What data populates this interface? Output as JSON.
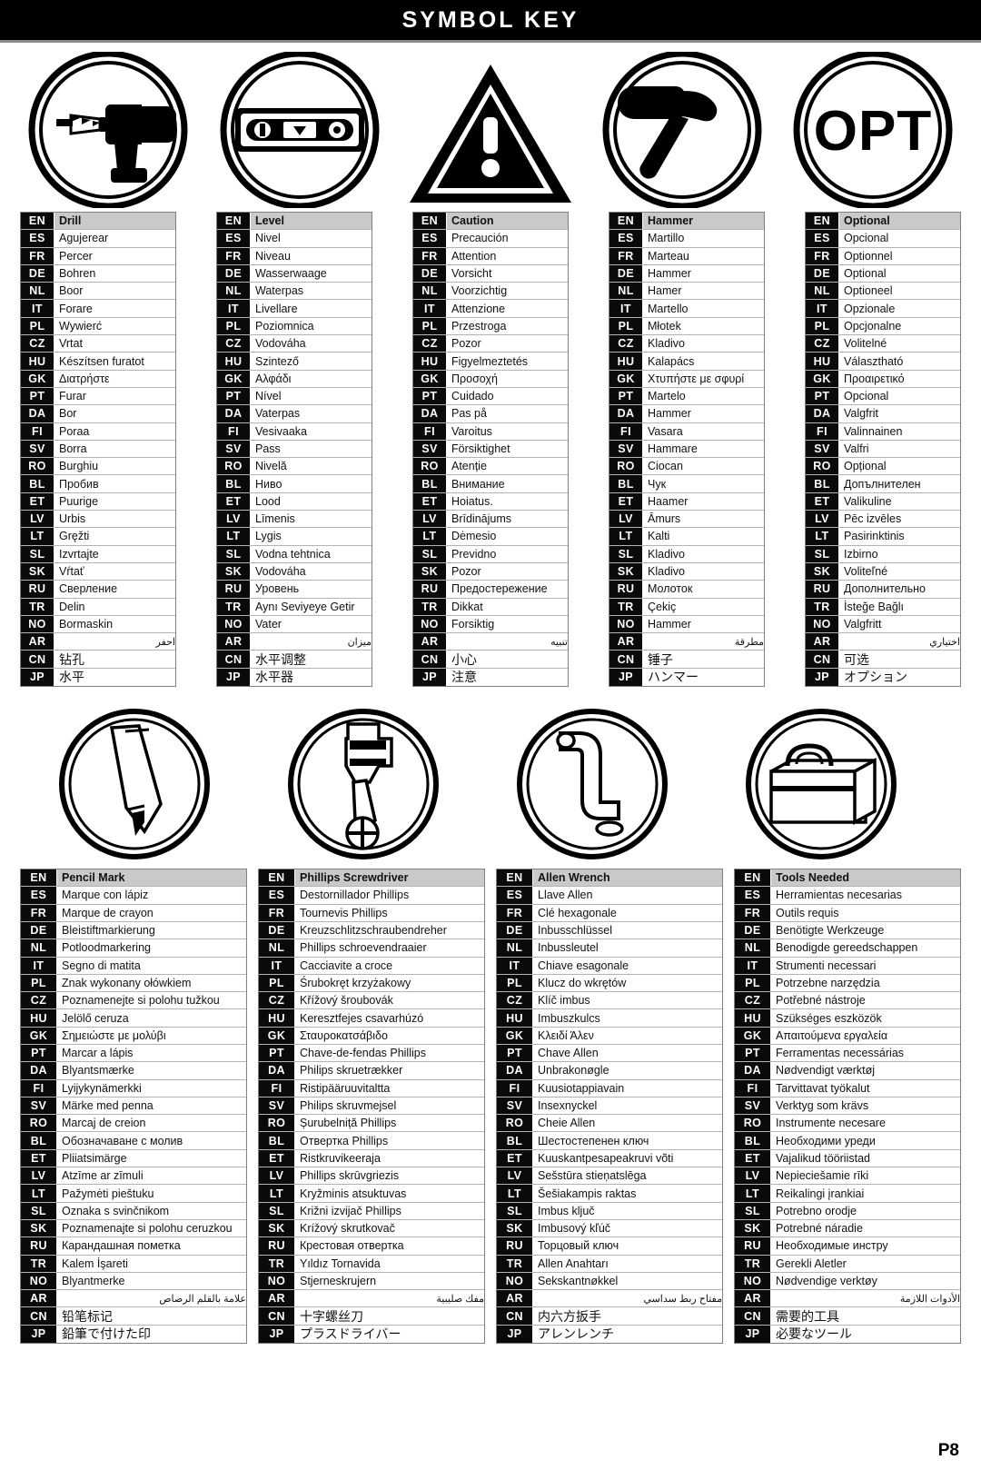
{
  "header": {
    "title": "SYMBOL KEY"
  },
  "footer": {
    "page": "P8"
  },
  "language_codes": [
    "EN",
    "ES",
    "FR",
    "DE",
    "NL",
    "IT",
    "PL",
    "CZ",
    "HU",
    "GK",
    "PT",
    "DA",
    "FI",
    "SV",
    "RO",
    "BL",
    "ET",
    "LV",
    "LT",
    "SL",
    "SK",
    "RU",
    "TR",
    "NO",
    "AR",
    "CN",
    "JP"
  ],
  "icons_top": [
    {
      "name": "drill-icon",
      "label": "Drill"
    },
    {
      "name": "level-icon",
      "label": "Level"
    },
    {
      "name": "caution-triangle-icon",
      "label": "Caution"
    },
    {
      "name": "hammer-icon",
      "label": "Hammer"
    },
    {
      "name": "optional-opt-icon",
      "label": "OPT"
    }
  ],
  "icons_bottom": [
    {
      "name": "pencil-icon",
      "label": "Pencil Mark"
    },
    {
      "name": "phillips-screwdriver-icon",
      "label": "Phillips Screwdriver"
    },
    {
      "name": "allen-wrench-icon",
      "label": "Allen Wrench"
    },
    {
      "name": "toolbox-icon",
      "label": "Tools Needed"
    }
  ],
  "tables_top": [
    {
      "id": "drill",
      "terms": [
        "Drill",
        "Agujerear",
        "Percer",
        "Bohren",
        "Boor",
        "Forare",
        "Wywierć",
        "Vrtat",
        "Készítsen furatot",
        "Διατρήστε",
        "Furar",
        "Bor",
        "Poraa",
        "Borra",
        "Burghiu",
        "Пробив",
        "Puurige",
        "Urbis",
        "Gręžti",
        "Izvrtajte",
        "Vŕtať",
        "Сверление",
        "Delin",
        "Bormaskin",
        "احفر",
        "钻孔",
        "水平"
      ]
    },
    {
      "id": "level",
      "terms": [
        "Level",
        "Nivel",
        "Niveau",
        "Wasserwaage",
        "Waterpas",
        "Livellare",
        "Poziomnica",
        "Vodováha",
        "Szintező",
        "Αλφάδι",
        "Nível",
        "Vaterpas",
        "Vesivaaka",
        "Pass",
        "Nivelă",
        "Ниво",
        "Lood",
        "Līmenis",
        "Lygis",
        "Vodna tehtnica",
        "Vodováha",
        "Уровень",
        "Aynı Seviyeye Getir",
        "Vater",
        "ميزان",
        "水平调整",
        "水平器"
      ]
    },
    {
      "id": "caution",
      "terms": [
        "Caution",
        "Precaución",
        "Attention",
        "Vorsicht",
        "Voorzichtig",
        "Attenzione",
        "Przestroga",
        "Pozor",
        "Figyelmeztetés",
        "Προσοχή",
        "Cuidado",
        "Pas på",
        "Varoitus",
        "Försiktighet",
        "Atenție",
        "Внимание",
        "Hoiatus.",
        "Brīdinājums",
        "Dėmesio",
        "Previdno",
        "Pozor",
        "Предостережение",
        "Dikkat",
        "Forsiktig",
        "تنبيه",
        "小心",
        "注意"
      ]
    },
    {
      "id": "hammer",
      "terms": [
        "Hammer",
        "Martillo",
        "Marteau",
        "Hammer",
        "Hamer",
        "Martello",
        "Młotek",
        "Kladivo",
        "Kalapács",
        "Χτυπήστε με σφυρί",
        "Martelo",
        "Hammer",
        "Vasara",
        "Hammare",
        "Ciocan",
        "Чук",
        "Haamer",
        "Āmurs",
        "Kalti",
        "Kladivo",
        "Kladivo",
        "Молоток",
        "Çekiç",
        "Hammer",
        "مطرقة",
        "锤子",
        "ハンマー"
      ]
    },
    {
      "id": "optional",
      "terms": [
        "Optional",
        "Opcional",
        "Optionnel",
        "Optional",
        "Optioneel",
        "Opzionale",
        "Opcjonalne",
        "Volitelné",
        "Választható",
        "Προαιρετικό",
        "Opcional",
        "Valgfrit",
        "Valinnainen",
        "Valfri",
        "Opțional",
        "Допълнителен",
        "Valikuline",
        "Pēc izvēles",
        "Pasirinktinis",
        "Izbirno",
        "Voliteľné",
        "Дополнительно",
        "İsteğe Bağlı",
        "Valgfritt",
        "اختياري",
        "可选",
        "オプション"
      ]
    }
  ],
  "tables_bottom": [
    {
      "id": "pencil-mark",
      "terms": [
        "Pencil Mark",
        "Marque con lápiz",
        "Marque de crayon",
        "Bleistiftmarkierung",
        "Potloodmarkering",
        "Segno di matita",
        "Znak wykonany ołówkiem",
        "Poznamenejte si polohu tužkou",
        "Jelölő ceruza",
        "Σημειώστε με μολύβι",
        "Marcar a lápis",
        "Blyantsmærke",
        "Lyijykynämerkki",
        "Märke med penna",
        "Marcaj de creion",
        "Обозначаване с молив",
        "Pliiatsimärge",
        "Atzīme ar zīmuli",
        "Pažymėti pieštuku",
        "Oznaka s svinčnikom",
        "Poznamenajte si polohu ceruzkou",
        "Карандашная пометка",
        "Kalem İşareti",
        "Blyantmerke",
        "علامة بالقلم الرصاص",
        "铅笔标记",
        "鉛筆で付けた印"
      ]
    },
    {
      "id": "phillips-screwdriver",
      "terms": [
        "Phillips Screwdriver",
        "Destornillador Phillips",
        "Tournevis Phillips",
        "Kreuzschlitzschraubendreher",
        "Phillips schroevendraaier",
        "Cacciavite a croce",
        "Śrubokręt krzyżakowy",
        "Křížový šroubovák",
        "Keresztfejes csavarhúzó",
        "Σταυροκατσάβιδο",
        "Chave-de-fendas Phillips",
        "Philips skruetrækker",
        "Ristipääruuvitaltta",
        "Philips skruvmejsel",
        "Șurubelniță Phillips",
        "Отвертка Phillips",
        "Ristkruvikeeraja",
        "Phillips skrūvgriezis",
        "Kryžminis atsuktuvas",
        "Križni izvijač Phillips",
        "Krížový skrutkovač",
        "Крестовая отвертка",
        "Yıldız Tornavida",
        "Stjerneskrujern",
        "مفك صليبية",
        "十字螺丝刀",
        "プラスドライバー"
      ]
    },
    {
      "id": "allen-wrench",
      "terms": [
        "Allen Wrench",
        "Llave Allen",
        "Clé hexagonale",
        "Inbusschlüssel",
        "Inbussleutel",
        "Chiave esagonale",
        "Klucz do wkrętów",
        "Klíč imbus",
        "Imbuszkulcs",
        "Κλειδί Άλεν",
        "Chave Allen",
        "Unbrakonøgle",
        "Kuusiotappiavain",
        "Insexnyckel",
        "Cheie Allen",
        "Шестостепенен ключ",
        "Kuuskantpesapeakruvi võti",
        "Sešstūra stieņatslēga",
        "Šešiakampis raktas",
        "Imbus ključ",
        "Imbusový kľúč",
        "Торцовый ключ",
        "Allen Anahtarı",
        "Sekskantnøkkel",
        "مفتاح ربط سداسي",
        "内六方扳手",
        "アレンレンチ"
      ]
    },
    {
      "id": "tools-needed",
      "terms": [
        "Tools Needed",
        "Herramientas necesarias",
        "Outils requis",
        "Benötigte Werkzeuge",
        "Benodigde gereedschappen",
        "Strumenti necessari",
        "Potrzebne narzędzia",
        "Potřebné nástroje",
        "Szükséges eszközök",
        "Απαιτούμενα εργαλεία",
        "Ferramentas necessárias",
        "Nødvendigt værktøj",
        "Tarvittavat työkalut",
        "Verktyg som krävs",
        "Instrumente necesare",
        "Необходими уреди",
        "Vajalikud tööriistad",
        "Nepieciešamie rīki",
        "Reikalingi įrankiai",
        "Potrebno orodje",
        "Potrebné náradie",
        "Необходимые инстру",
        "Gerekli Aletler",
        "Nødvendige verktøy",
        "الأدوات اللازمة",
        "需要的工具",
        "必要なツール"
      ]
    }
  ]
}
